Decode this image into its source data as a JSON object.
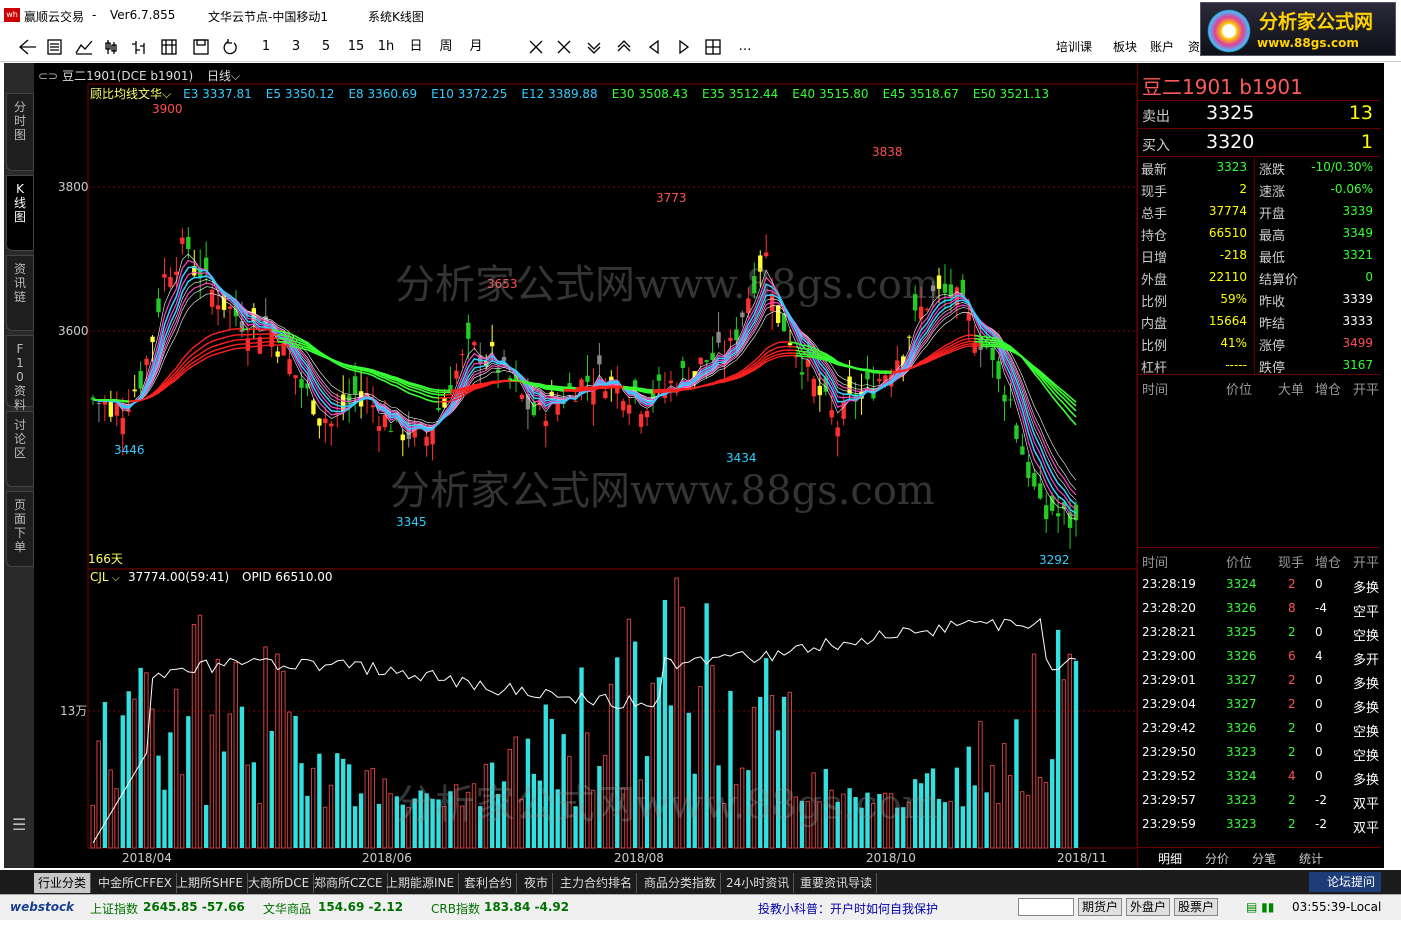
{
  "titlebar": {
    "app": "赢顺云交易",
    "sep": "-",
    "version": "Ver6.7.855",
    "node": "文华云节点-中国移动1",
    "view": "系统K线图"
  },
  "brand": {
    "name": "分析家公式网",
    "url": "www.88gs.com"
  },
  "toolbar": {
    "icons": [
      "back-icon",
      "list-icon",
      "line-icon",
      "candle-icon",
      "bar-icon",
      "grid-icon",
      "save-icon",
      "refresh-icon"
    ],
    "periods": [
      "1",
      "3",
      "5",
      "15",
      "1h",
      "日",
      "周",
      "月"
    ],
    "more": "…",
    "right": [
      "培训课",
      "板块",
      "账户",
      "资讯"
    ]
  },
  "sidetabs": [
    "分时图",
    "K线图",
    "资讯链",
    "F10资料",
    "讨论区",
    "页面下单"
  ],
  "chart": {
    "symbol": "豆二1901(DCE b1901)",
    "period": "日线",
    "study": "顾比均线文华",
    "ma": [
      {
        "label": "E3 3337.81",
        "color": "#33ccff"
      },
      {
        "label": "E5 3350.12",
        "color": "#33ccff"
      },
      {
        "label": "E8 3360.69",
        "color": "#33ccff"
      },
      {
        "label": "E10 3372.25",
        "color": "#33ccff"
      },
      {
        "label": "E12 3389.88",
        "color": "#33ccff"
      },
      {
        "label": "E30 3508.43",
        "color": "#33ff33"
      },
      {
        "label": "E35 3512.44",
        "color": "#33ff33"
      },
      {
        "label": "E40 3515.80",
        "color": "#33ff33"
      },
      {
        "label": "E45 3518.67",
        "color": "#33ff33"
      },
      {
        "label": "E50 3521.13",
        "color": "#33ff33"
      }
    ],
    "yticks": [
      "3800",
      "3600"
    ],
    "days": "166天",
    "peaks": [
      {
        "label": "3900",
        "c": "#ff5050"
      },
      {
        "label": "3653",
        "c": "#ff5050"
      },
      {
        "label": "3773",
        "c": "#ff5050"
      },
      {
        "label": "3838",
        "c": "#ff5050"
      },
      {
        "label": "3446",
        "c": "#33ccff"
      },
      {
        "label": "3345",
        "c": "#33ccff"
      },
      {
        "label": "3434",
        "c": "#33ccff"
      },
      {
        "label": "3292",
        "c": "#33ccff"
      }
    ],
    "vol": {
      "name": "CJL",
      "value": "37774.00(59:41)",
      "opid": "OPID 66510.00",
      "ytick": "13万"
    },
    "xdates": [
      "2018/04",
      "2018/06",
      "2018/08",
      "2018/10",
      "2018/11"
    ]
  },
  "watermark": "分析家公式网www.88gs.com",
  "quote": {
    "title": "豆二1901  b1901",
    "sell": {
      "label": "卖出",
      "price": "3325",
      "vol": "13"
    },
    "buy": {
      "label": "买入",
      "price": "3320",
      "vol": "1"
    },
    "left": [
      {
        "k": "最新",
        "v": "3323",
        "c": "#33ff33"
      },
      {
        "k": "现手",
        "v": "2",
        "c": "#ffff00"
      },
      {
        "k": "总手",
        "v": "37774",
        "c": "#ffff00"
      },
      {
        "k": "持仓",
        "v": "66510",
        "c": "#ffff00"
      },
      {
        "k": "日增",
        "v": "-218",
        "c": "#ffff00"
      },
      {
        "k": "外盘",
        "v": "22110",
        "c": "#ffff00"
      },
      {
        "k": "比例",
        "v": "59%",
        "c": "#ffff00"
      },
      {
        "k": "内盘",
        "v": "15664",
        "c": "#ffff00"
      },
      {
        "k": "比例",
        "v": "41%",
        "c": "#ffff00"
      },
      {
        "k": "杠杆",
        "v": "-----",
        "c": "#ffff00"
      }
    ],
    "right": [
      {
        "k": "涨跌",
        "v": "-10/0.30%",
        "c": "#33ff33"
      },
      {
        "k": "速涨",
        "v": "-0.06%",
        "c": "#33ff33"
      },
      {
        "k": "开盘",
        "v": "3339",
        "c": "#33ff33"
      },
      {
        "k": "最高",
        "v": "3349",
        "c": "#33ff33"
      },
      {
        "k": "最低",
        "v": "3321",
        "c": "#33ff33"
      },
      {
        "k": "结算价",
        "v": "0",
        "c": "#33ff33"
      },
      {
        "k": "昨收",
        "v": "3339",
        "c": "#ffffff"
      },
      {
        "k": "昨结",
        "v": "3333",
        "c": "#ffffff"
      },
      {
        "k": "涨停",
        "v": "3499",
        "c": "#ff5050"
      },
      {
        "k": "跌停",
        "v": "3167",
        "c": "#33ff33"
      }
    ],
    "hdr1": [
      "时间",
      "价位",
      "大单",
      "增仓",
      "开平"
    ],
    "hdr2": [
      "时间",
      "价位",
      "现手",
      "增仓",
      "开平"
    ],
    "ticks": [
      {
        "t": "23:28:19",
        "p": "3324",
        "n": "2",
        "z": "0",
        "o": "多换",
        "nc": "#ff5050"
      },
      {
        "t": "23:28:20",
        "p": "3326",
        "n": "8",
        "z": "-4",
        "o": "空平",
        "nc": "#ff5050"
      },
      {
        "t": "23:28:21",
        "p": "3325",
        "n": "2",
        "z": "0",
        "o": "空换",
        "nc": "#33ff33"
      },
      {
        "t": "23:29:00",
        "p": "3326",
        "n": "6",
        "z": "4",
        "o": "多开",
        "nc": "#ff5050"
      },
      {
        "t": "23:29:01",
        "p": "3327",
        "n": "2",
        "z": "0",
        "o": "多换",
        "nc": "#ff5050"
      },
      {
        "t": "23:29:04",
        "p": "3327",
        "n": "2",
        "z": "0",
        "o": "多换",
        "nc": "#ff5050"
      },
      {
        "t": "23:29:42",
        "p": "3326",
        "n": "2",
        "z": "0",
        "o": "空换",
        "nc": "#33ff33"
      },
      {
        "t": "23:29:50",
        "p": "3323",
        "n": "2",
        "z": "0",
        "o": "空换",
        "nc": "#33ff33"
      },
      {
        "t": "23:29:52",
        "p": "3324",
        "n": "4",
        "z": "0",
        "o": "多换",
        "nc": "#ff5050"
      },
      {
        "t": "23:29:57",
        "p": "3323",
        "n": "2",
        "z": "-2",
        "o": "双平",
        "nc": "#33ff33"
      },
      {
        "t": "23:29:59",
        "p": "3323",
        "n": "2",
        "z": "-2",
        "o": "双平",
        "nc": "#33ff33"
      }
    ],
    "tabs": [
      "明细",
      "分价",
      "分笔",
      "统计"
    ]
  },
  "bottomtabs": [
    "行业分类",
    "中金所CFFEX",
    "上期所SHFE",
    "大商所DCE",
    "郑商所CZCE",
    "上期能源INE",
    "套利合约",
    "夜市",
    "主力合约排名",
    "商品分类指数",
    "24小时资讯",
    "重要资讯导读"
  ],
  "forum": "论坛提问",
  "status": {
    "logo": "webstock",
    "idx": [
      {
        "n": "上证指数",
        "v": "2645.85 -57.66"
      },
      {
        "n": "文华商品",
        "v": "154.69 -2.12"
      },
      {
        "n": "CRB指数",
        "v": "183.84 -4.92"
      }
    ],
    "tip": "投教小科普：开户时如何自我保护",
    "btns": [
      "期货户",
      "外盘户",
      "股票户"
    ],
    "time": "03:55:39-Local"
  }
}
